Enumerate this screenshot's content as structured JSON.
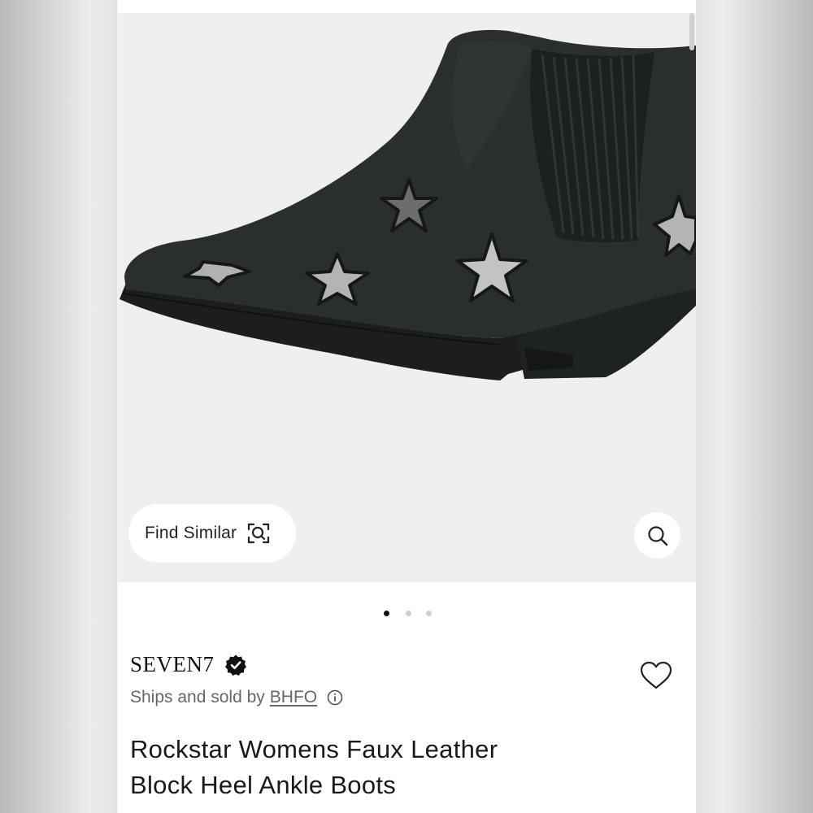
{
  "gallery": {
    "find_similar_label": "Find Similar",
    "find_similar_icon": "camera-search-icon",
    "zoom_icon": "search-icon",
    "image_count": 3,
    "active_image_index": 1,
    "image_alt": "black ankle boot with silver stars"
  },
  "product": {
    "brand": "SEVEN7",
    "verified_icon": "verified-badge-icon",
    "ships_prefix": "Ships and sold by",
    "seller": "BHFO",
    "info_icon": "info-icon",
    "wishlist_icon": "heart-icon",
    "title_line1": "Rockstar Womens Faux Leather",
    "title_line2": "Block Heel Ankle Boots"
  },
  "colors": {
    "gallery_bg": "#efefef",
    "boot": "#2a2f2d",
    "star_silver": "#b7b9b8",
    "text_primary": "#1a1a1a",
    "text_secondary": "#666666"
  }
}
